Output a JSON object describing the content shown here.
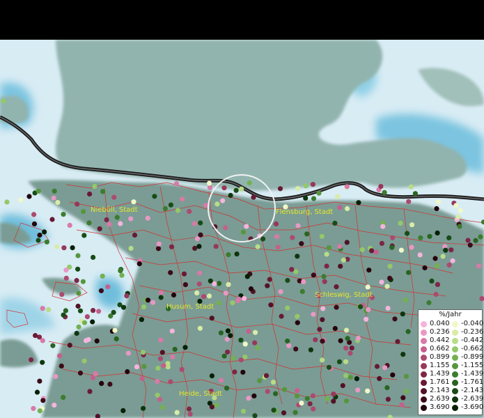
{
  "cities": {
    "niebull": "Niebüll, Stadt",
    "flensburg": "Flensburg, Stadt",
    "husum": "Husum, Stadt",
    "schleswig": "Schleswig, Stadt",
    "heide": "Heide, Stadt"
  },
  "legend": {
    "title": "%/Jahr",
    "positive": [
      {
        "label": "0.040",
        "color": "#f4b4dc"
      },
      {
        "label": "0.236",
        "color": "#e898c4"
      },
      {
        "label": "0.442",
        "color": "#d87aa8"
      },
      {
        "label": "0.662",
        "color": "#c4608c"
      },
      {
        "label": "0.899",
        "color": "#ac4a70"
      },
      {
        "label": "1.155",
        "color": "#96385a"
      },
      {
        "label": "1.439",
        "color": "#7e2646"
      },
      {
        "label": "1.761",
        "color": "#681a34"
      },
      {
        "label": "2.143",
        "color": "#521226"
      },
      {
        "label": "2.639",
        "color": "#3c0a18"
      },
      {
        "label": "3.690",
        "color": "#24040c"
      }
    ],
    "negative": [
      {
        "label": "-0.040",
        "color": "#f0f8c8"
      },
      {
        "label": "-0.236",
        "color": "#d8eca8"
      },
      {
        "label": "-0.442",
        "color": "#b8dc88"
      },
      {
        "label": "-0.662",
        "color": "#94c86a"
      },
      {
        "label": "-0.899",
        "color": "#74b052"
      },
      {
        "label": "-1.155",
        "color": "#56963e"
      },
      {
        "label": "-1.439",
        "color": "#3c7c2e"
      },
      {
        "label": "-1.761",
        "color": "#286422"
      },
      {
        "label": "-2.143",
        "color": "#184c16"
      },
      {
        "label": "-2.639",
        "color": "#0e360e"
      },
      {
        "label": "-3.690",
        "color": "#062006"
      }
    ]
  }
}
